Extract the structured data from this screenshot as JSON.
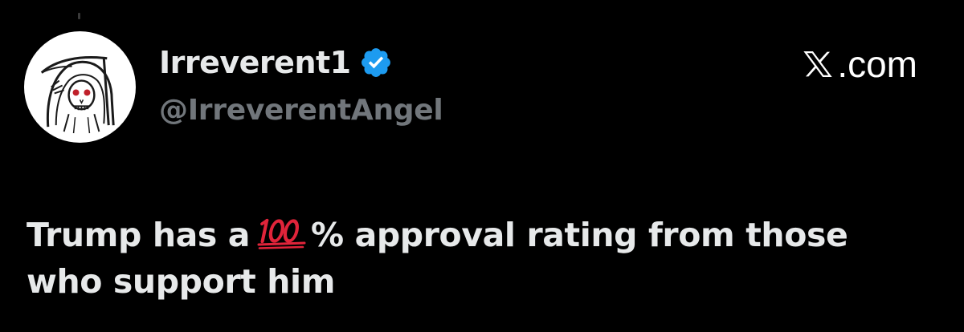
{
  "tweet": {
    "display_name": "Irreverent1",
    "handle": "@IrreverentAngel",
    "brand_domain": ".com",
    "text_before_emoji": "Trump has a",
    "text_after_emoji": "% approval rating from those who support him",
    "emoji": "100-points-icon"
  },
  "icons": {
    "avatar": "grim-reaper-avatar",
    "verified": "verified-badge-icon",
    "brand": "x-logo-icon"
  },
  "colors": {
    "background": "#000000",
    "text_primary": "#e7e9ea",
    "text_secondary": "#71767b",
    "verified_blue": "#1d9bf0",
    "emoji_red": "#e0243a"
  }
}
